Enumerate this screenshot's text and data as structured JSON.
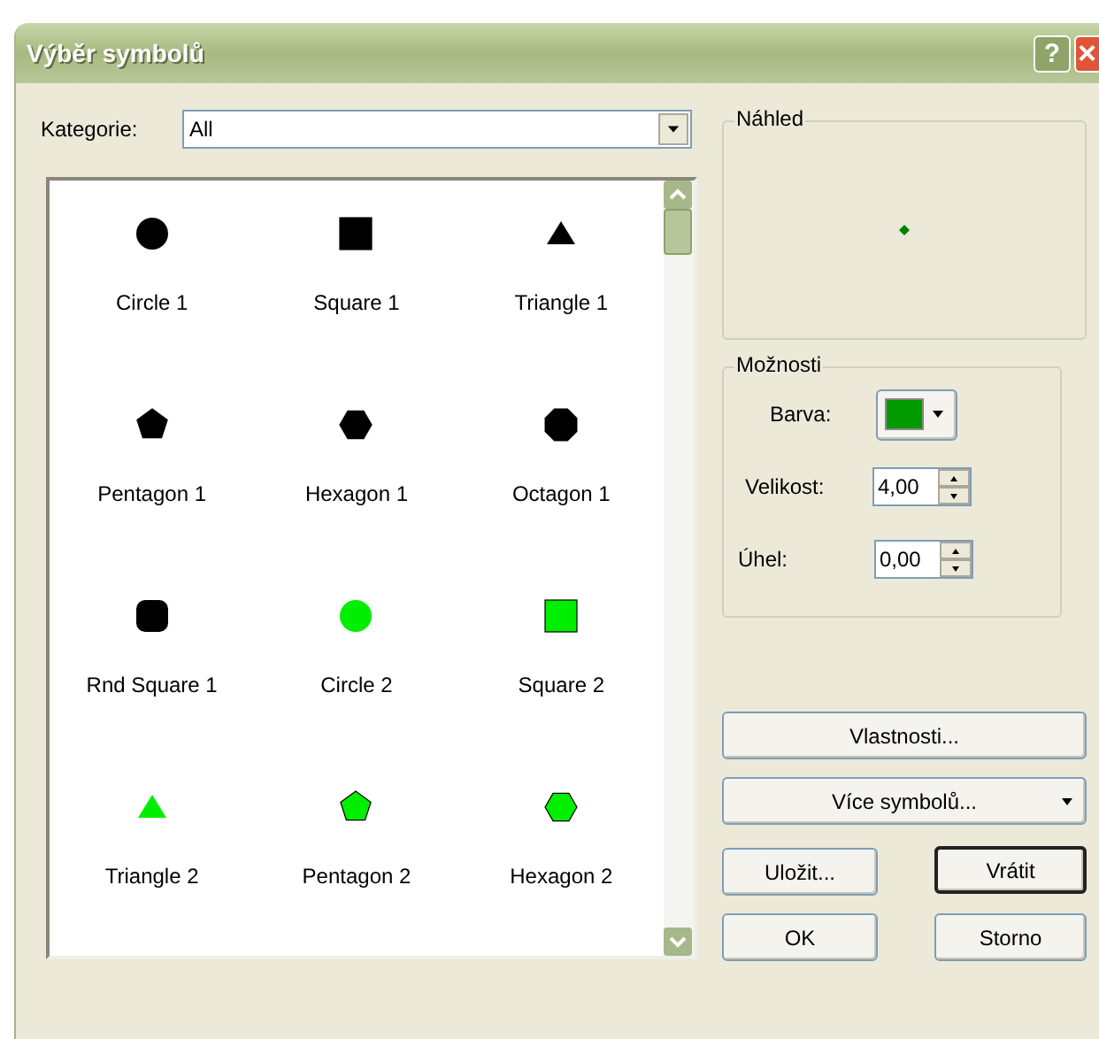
{
  "window": {
    "title": "Výběr symbolů",
    "help": "?",
    "close": "×"
  },
  "category": {
    "label": "Kategorie:",
    "value": "All"
  },
  "symbols": [
    {
      "kind": "circle",
      "color": "#000000",
      "label": "Circle 1"
    },
    {
      "kind": "square",
      "color": "#000000",
      "label": "Square 1"
    },
    {
      "kind": "triangle",
      "color": "#000000",
      "label": "Triangle 1"
    },
    {
      "kind": "pentagon",
      "color": "#000000",
      "label": "Pentagon 1"
    },
    {
      "kind": "hexagon",
      "color": "#000000",
      "label": "Hexagon 1"
    },
    {
      "kind": "octagon",
      "color": "#000000",
      "label": "Octagon 1"
    },
    {
      "kind": "rounded-square",
      "color": "#000000",
      "label": "Rnd Square 1"
    },
    {
      "kind": "circle",
      "color": "#00ee00",
      "label": "Circle 2"
    },
    {
      "kind": "square",
      "color": "#00ee00",
      "label": "Square 2"
    },
    {
      "kind": "triangle",
      "color": "#00ee00",
      "label": "Triangle 2"
    },
    {
      "kind": "pentagon",
      "color": "#00ee00",
      "label": "Pentagon 2"
    },
    {
      "kind": "hexagon",
      "color": "#00ee00",
      "label": "Hexagon 2"
    }
  ],
  "preview": {
    "title": "Náhled",
    "color": "#008000"
  },
  "options": {
    "title": "Možnosti",
    "color_label": "Barva:",
    "color": "#009900",
    "size_label": "Velikost:",
    "size": "4,00",
    "angle_label": "Úhel:",
    "angle": "0,00"
  },
  "buttons": {
    "properties": "Vlastnosti...",
    "more": "Více symbolů...",
    "save": "Uložit...",
    "reset": "Vrátit",
    "ok": "OK",
    "cancel": "Storno"
  }
}
